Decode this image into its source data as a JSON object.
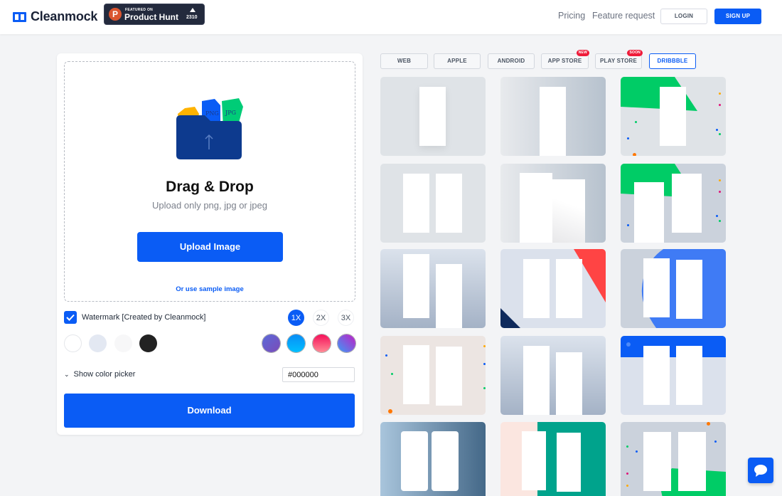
{
  "header": {
    "brand": "Cleanmock",
    "product_hunt": {
      "small": "FEATURED ON",
      "big": "Product Hunt",
      "count": "2310",
      "logo_letter": "P"
    },
    "nav": [
      {
        "label": "Pricing"
      },
      {
        "label": "Feature request"
      }
    ],
    "login_label": "LOGIN",
    "signup_label": "SIGN UP"
  },
  "upload": {
    "title": "Drag & Drop",
    "subtitle": "Upload only png, jpg or jpeg",
    "upload_button": "Upload Image",
    "sample_link": "Or use sample image",
    "illustration_labels": [
      "PNG",
      "JPG"
    ]
  },
  "options": {
    "watermark_label": "Watermark [Created by Cleanmock]",
    "watermark_checked": true,
    "scales": [
      {
        "label": "1X",
        "active": true
      },
      {
        "label": "2X",
        "active": false
      },
      {
        "label": "3X",
        "active": false
      }
    ],
    "solid_swatches": [
      "#ffffff",
      "#e3e8f2",
      "#f7f7f8",
      "#222222"
    ],
    "gradient_swatches": [
      {
        "name": "purple-gradient",
        "from": "#6a5acd",
        "to": "#7b4bb8"
      },
      {
        "name": "blue-gradient",
        "from": "#0a8df5",
        "to": "#00bfff"
      },
      {
        "name": "red-gradient",
        "from": "#f5105a",
        "to": "#ff7f8f"
      },
      {
        "name": "purple-blue-gradient",
        "from": "#c21ec4",
        "to": "#3b9cf7"
      }
    ],
    "color_picker_label": "Show color picker",
    "hex_value": "#000000",
    "download_label": "Download"
  },
  "tabs": [
    {
      "label": "WEB",
      "active": false,
      "badge": null
    },
    {
      "label": "APPLE",
      "active": false,
      "badge": null
    },
    {
      "label": "ANDROID",
      "active": false,
      "badge": null
    },
    {
      "label": "APP STORE",
      "active": false,
      "badge": "NEW"
    },
    {
      "label": "PLAY STORE",
      "active": false,
      "badge": "SOON"
    },
    {
      "label": "DRIBBBLE",
      "active": true,
      "badge": null
    }
  ],
  "colors": {
    "accent": "#0a5cf5",
    "green": "#00cc66",
    "red": "#ff4444",
    "navy": "#0f2a5c",
    "teal": "#00a38c"
  }
}
